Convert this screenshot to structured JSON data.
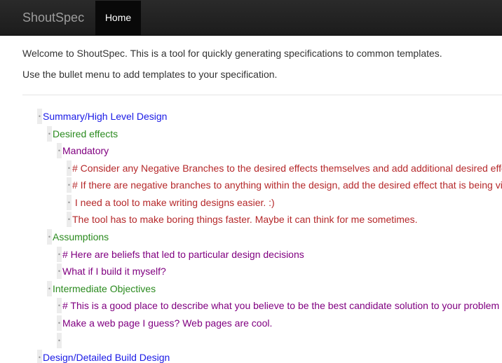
{
  "navbar": {
    "brand": "ShoutSpec",
    "home_label": "Home"
  },
  "intro": {
    "line1": "Welcome to ShoutSpec. This is a tool for quickly generating specifications to common templates.",
    "line2": "Use the bullet menu to add templates to your specification."
  },
  "bullet_glyph": "•",
  "colors": {
    "level1": "#1a1ae6",
    "level2": "#2a8a1e",
    "level3": "#800080",
    "level4": "#b5282a"
  },
  "tree": [
    {
      "text": "Summary/High Level Design",
      "level": 1
    },
    {
      "text": "Desired effects",
      "level": 2
    },
    {
      "text": "Mandatory",
      "level": 3
    },
    {
      "text": "# Consider any Negative Branches to the desired effects themselves and add additional desired effects",
      "level": 4
    },
    {
      "text": "# If there are negative branches to anything within the design, add the desired effect that is being violated",
      "level": 4
    },
    {
      "text": " I need a tool to make writing designs easier. :)",
      "level": 4
    },
    {
      "text": "The tool has to make boring things faster. Maybe it can think for me sometimes.",
      "level": 4
    },
    {
      "text": "Assumptions",
      "level": 2
    },
    {
      "text": "# Here are beliefs that led to particular design decisions",
      "level": 3
    },
    {
      "text": "What if I build it myself?",
      "level": 3
    },
    {
      "text": "Intermediate Objectives",
      "level": 2
    },
    {
      "text": "# This is a good place to describe what you believe to be the best candidate solution to your problem",
      "level": 3
    },
    {
      "text": "Make a web page I guess? Web pages are cool.",
      "level": 3
    },
    {
      "text": "",
      "level": 3
    },
    {
      "text": "Design/Detailed Build Design",
      "level": 1
    }
  ]
}
